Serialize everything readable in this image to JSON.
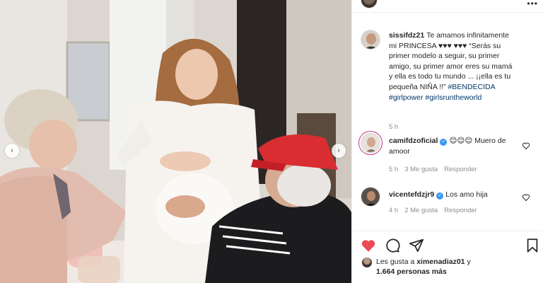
{
  "post": {
    "header_more": "•••",
    "caption": {
      "username": "sissifdz21",
      "text": "Te amamos infinitamente mi PRINCESA ♥♥♥ ♥♥♥ “Serás su primer modelo a seguir, su primer amigo, su primer amor eres su mamá y ella es todo tu mundo ... ¡¡ella es tu pequeña NIÑA !!” ",
      "hashtags_line1": "#BENDECIDA",
      "hashtags_line2": "#girlpower #girlsruntheworld",
      "time": "5 h"
    },
    "comments": [
      {
        "username": "camifdzoficial",
        "verified_mark": "✓",
        "text": "😊😊😊 Muero de amoor",
        "time": "5 h",
        "likes": "3 Me gusta",
        "reply": "Responder"
      },
      {
        "username": "vicentefdzjr9",
        "verified_mark": "✓",
        "text": "Los amo hija",
        "time": "4 h",
        "likes": "2 Me gusta",
        "reply": "Responder"
      }
    ],
    "liked_by_prefix": "Les gusta a",
    "liked_by_user": "ximenadiaz01",
    "liked_by_suffix": "y",
    "likes_count": "1.664 personas más"
  },
  "carousel": {
    "prev": "‹",
    "next": "›"
  },
  "colors": {
    "like_red": "#ed4956",
    "link_blue": "#00376b",
    "muted": "#8e8e8e",
    "verified": "#3897f0"
  },
  "icons": [
    "heart-icon",
    "comment-icon",
    "share-icon",
    "bookmark-icon",
    "small-heart-icon",
    "verified-icon"
  ]
}
